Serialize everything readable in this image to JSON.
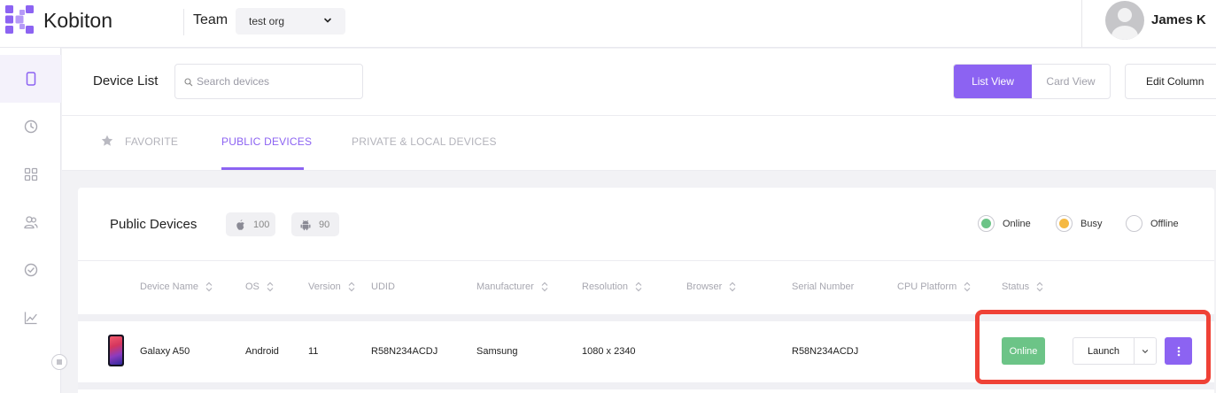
{
  "app": {
    "brand": "Kobiton"
  },
  "topbar": {
    "team_label": "Team",
    "org_value": "test org",
    "user_name": "James K"
  },
  "sidebar": {
    "items": [
      "device-list",
      "history",
      "apps",
      "team",
      "sessions",
      "analytics"
    ]
  },
  "header": {
    "title": "Device List",
    "search_placeholder": "Search devices",
    "list_view_label": "List View",
    "card_view_label": "Card View",
    "edit_column_label": "Edit Column"
  },
  "tabs": [
    {
      "label": "FAVORITE"
    },
    {
      "label": "PUBLIC DEVICES"
    },
    {
      "label": "PRIVATE & LOCAL DEVICES"
    }
  ],
  "card": {
    "title": "Public Devices",
    "ios_count": "100",
    "android_count": "90",
    "legend": [
      {
        "label": "Online",
        "color": "#6cc487"
      },
      {
        "label": "Busy",
        "color": "#f5b942"
      },
      {
        "label": "Offline",
        "color": "#ffffff"
      }
    ]
  },
  "table": {
    "columns": [
      "Device Name",
      "OS",
      "Version",
      "UDID",
      "Manufacturer",
      "Resolution",
      "Browser",
      "Serial Number",
      "CPU Platform",
      "Status"
    ],
    "rows": [
      {
        "device_name": "Galaxy A50",
        "os": "Android",
        "version": "11",
        "udid": "R58N234ACDJ",
        "manufacturer": "Samsung",
        "resolution": "1080 x 2340",
        "browser": "",
        "serial_number": "R58N234ACDJ",
        "cpu_platform": "",
        "status": "Online",
        "launch_label": "Launch"
      }
    ]
  },
  "colors": {
    "accent": "#8c63f2",
    "online": "#6cc487",
    "highlight": "#ef4136"
  }
}
